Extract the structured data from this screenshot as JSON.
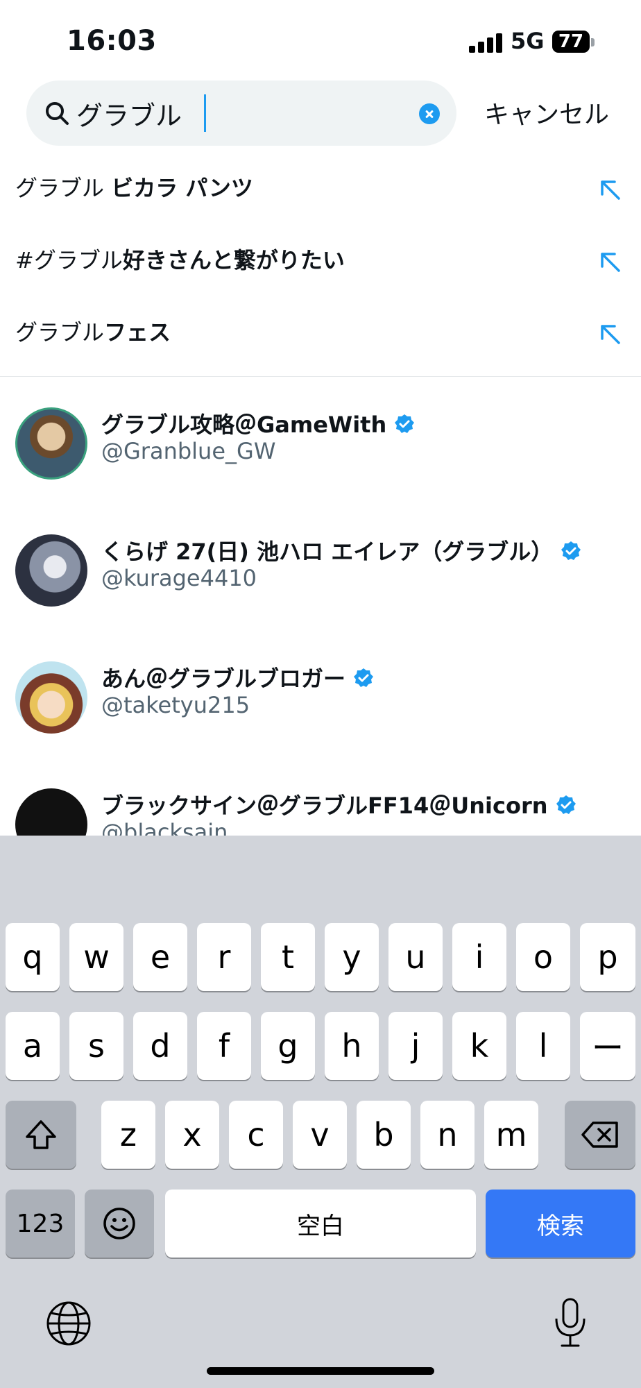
{
  "status_bar": {
    "time": "16:03",
    "network": "5G",
    "battery": "77"
  },
  "search": {
    "value": "グラブル",
    "cancel_label": "キャンセル"
  },
  "suggestions": [
    {
      "prefix": "グラブル ",
      "bold": "ビカラ パンツ"
    },
    {
      "prefix": "#グラブル",
      "bold": "好きさんと繋がりたい"
    },
    {
      "prefix": "グラブル",
      "bold": "フェス"
    }
  ],
  "users": [
    {
      "name": "グラブル攻略＠GameWith",
      "handle": "@Granblue_GW",
      "verified": true
    },
    {
      "name": "くらげ 27(日) 池ハロ エイレア（グラブル）",
      "handle": "@kurage4410",
      "verified": true
    },
    {
      "name": "あん＠グラブルブロガー",
      "handle": "@taketyu215",
      "verified": true
    },
    {
      "name": "ブラックサイン＠グラブルFF14＠Unicorn",
      "handle": "@blacksain",
      "verified": true
    }
  ],
  "keyboard": {
    "row1": [
      "q",
      "w",
      "e",
      "r",
      "t",
      "y",
      "u",
      "i",
      "o",
      "p"
    ],
    "row2": [
      "a",
      "s",
      "d",
      "f",
      "g",
      "h",
      "j",
      "k",
      "l",
      "ー"
    ],
    "row3": [
      "z",
      "x",
      "c",
      "v",
      "b",
      "n",
      "m"
    ],
    "num_label": "123",
    "space_label": "空白",
    "search_label": "検索"
  },
  "colors": {
    "accent": "#1d9bf0",
    "keyboard_bg": "#d1d4da",
    "search_key": "#3478f6"
  }
}
